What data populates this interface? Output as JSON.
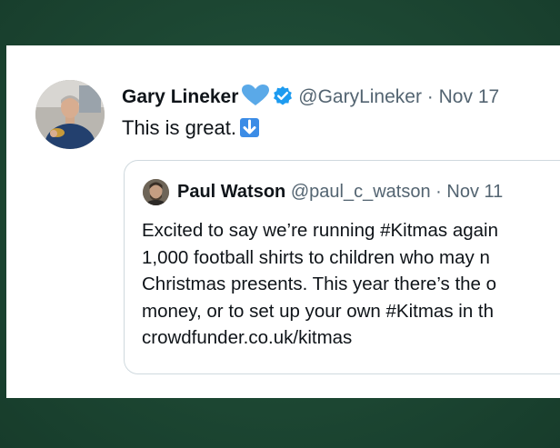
{
  "tweet": {
    "author_name": "Gary Lineker",
    "handle": "@GaryLineker",
    "separator": "·",
    "date": "Nov 17",
    "text": "This is great.",
    "icons": [
      "blue-heart-icon",
      "verified-badge-icon",
      "down-arrow-emoji-icon"
    ],
    "accent_color": "#1d9bf0"
  },
  "quoted_tweet": {
    "author_name": "Paul Watson",
    "handle": "@paul_c_watson",
    "separator": "·",
    "date": "Nov 11",
    "lines": [
      "Excited to say we’re running #Kitmas again",
      "1,000 football shirts to children who may n",
      "Christmas presents. This year there’s the o",
      "money, or to set up your own #Kitmas in th",
      "crowdfunder.co.uk/kitmas"
    ]
  },
  "colors": {
    "background": "#1d4a35",
    "card": "#ffffff",
    "muted_text": "#536471",
    "border": "#cfd9de"
  }
}
